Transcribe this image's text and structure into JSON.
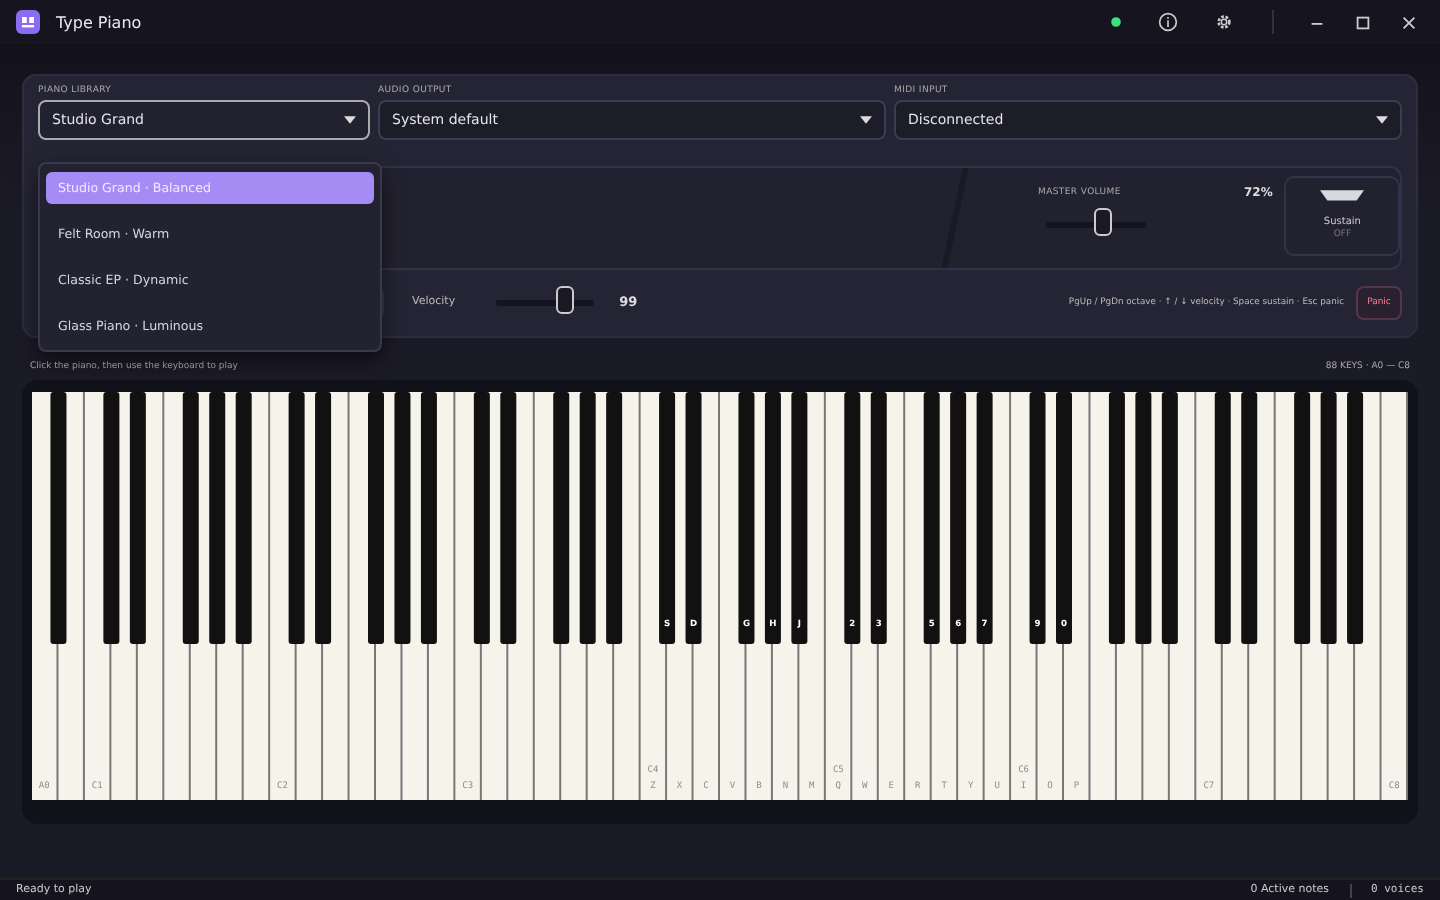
{
  "window": {
    "title": "Type Piano"
  },
  "selects": [
    {
      "label": "PIANO LIBRARY",
      "value": "Studio Grand",
      "open": true
    },
    {
      "label": "AUDIO OUTPUT",
      "value": "System default",
      "open": false
    },
    {
      "label": "MIDI INPUT",
      "value": "Disconnected",
      "open": false
    }
  ],
  "library_menu": [
    {
      "label": "Studio Grand · Balanced",
      "selected": true
    },
    {
      "label": "Felt Room · Warm",
      "selected": false
    },
    {
      "label": "Classic EP · Dynamic",
      "selected": false
    },
    {
      "label": "Glass Piano · Luminous",
      "selected": false
    }
  ],
  "master_volume": {
    "label": "MASTER VOLUME",
    "reading": "72%",
    "level": 0.56
  },
  "sustain": {
    "label": "Sustain",
    "state": "OFF"
  },
  "velocity": {
    "label": "Velocity",
    "reading": "99",
    "level": 0.72
  },
  "shortcuts": "PgUp / PgDn octave · ↑ / ↓ velocity · Space sustain · Esc panic",
  "panic_button": "Panic",
  "play_hint": "Click the piano, then use the keyboard to play",
  "range_label": "88 KEYS · A0 — C8",
  "keys": [
    {
      "kind": "white",
      "note": "A0"
    },
    {
      "kind": "black"
    },
    {
      "kind": "white"
    },
    {
      "kind": "white",
      "note": "C1"
    },
    {
      "kind": "black"
    },
    {
      "kind": "white"
    },
    {
      "kind": "black"
    },
    {
      "kind": "white"
    },
    {
      "kind": "white"
    },
    {
      "kind": "black"
    },
    {
      "kind": "white"
    },
    {
      "kind": "black"
    },
    {
      "kind": "white"
    },
    {
      "kind": "black"
    },
    {
      "kind": "white"
    },
    {
      "kind": "white",
      "note": "C2"
    },
    {
      "kind": "black"
    },
    {
      "kind": "white"
    },
    {
      "kind": "black"
    },
    {
      "kind": "white"
    },
    {
      "kind": "white"
    },
    {
      "kind": "black"
    },
    {
      "kind": "white"
    },
    {
      "kind": "black"
    },
    {
      "kind": "white"
    },
    {
      "kind": "black"
    },
    {
      "kind": "white"
    },
    {
      "kind": "white",
      "note": "C3"
    },
    {
      "kind": "black"
    },
    {
      "kind": "white"
    },
    {
      "kind": "black"
    },
    {
      "kind": "white"
    },
    {
      "kind": "white"
    },
    {
      "kind": "black"
    },
    {
      "kind": "white"
    },
    {
      "kind": "black"
    },
    {
      "kind": "white"
    },
    {
      "kind": "black"
    },
    {
      "kind": "white"
    },
    {
      "kind": "white",
      "note": "C4",
      "key": "Z"
    },
    {
      "kind": "black",
      "key": "S"
    },
    {
      "kind": "white",
      "key": "X"
    },
    {
      "kind": "black",
      "key": "D"
    },
    {
      "kind": "white",
      "key": "C"
    },
    {
      "kind": "white",
      "key": "V"
    },
    {
      "kind": "black",
      "key": "G"
    },
    {
      "kind": "white",
      "key": "B"
    },
    {
      "kind": "black",
      "key": "H"
    },
    {
      "kind": "white",
      "key": "N"
    },
    {
      "kind": "black",
      "key": "J"
    },
    {
      "kind": "white",
      "key": "M"
    },
    {
      "kind": "white",
      "note": "C5",
      "key": "Q"
    },
    {
      "kind": "black",
      "key": "2"
    },
    {
      "kind": "white",
      "key": "W"
    },
    {
      "kind": "black",
      "key": "3"
    },
    {
      "kind": "white",
      "key": "E"
    },
    {
      "kind": "white",
      "key": "R"
    },
    {
      "kind": "black",
      "key": "5"
    },
    {
      "kind": "white",
      "key": "T"
    },
    {
      "kind": "black",
      "key": "6"
    },
    {
      "kind": "white",
      "key": "Y"
    },
    {
      "kind": "black",
      "key": "7"
    },
    {
      "kind": "white",
      "key": "U"
    },
    {
      "kind": "white",
      "note": "C6",
      "key": "I"
    },
    {
      "kind": "black",
      "key": "9"
    },
    {
      "kind": "white",
      "key": "O"
    },
    {
      "kind": "black",
      "key": "0"
    },
    {
      "kind": "white",
      "key": "P"
    },
    {
      "kind": "white"
    },
    {
      "kind": "black"
    },
    {
      "kind": "white"
    },
    {
      "kind": "black"
    },
    {
      "kind": "white"
    },
    {
      "kind": "black"
    },
    {
      "kind": "white"
    },
    {
      "kind": "white",
      "note": "C7"
    },
    {
      "kind": "black"
    },
    {
      "kind": "white"
    },
    {
      "kind": "black"
    },
    {
      "kind": "white"
    },
    {
      "kind": "white"
    },
    {
      "kind": "black"
    },
    {
      "kind": "white"
    },
    {
      "kind": "black"
    },
    {
      "kind": "white"
    },
    {
      "kind": "black"
    },
    {
      "kind": "white"
    },
    {
      "kind": "white",
      "note": "C8"
    }
  ],
  "status_bar": {
    "message": "Ready to play",
    "active_notes": "0 Active notes",
    "voices": "0 voices"
  }
}
